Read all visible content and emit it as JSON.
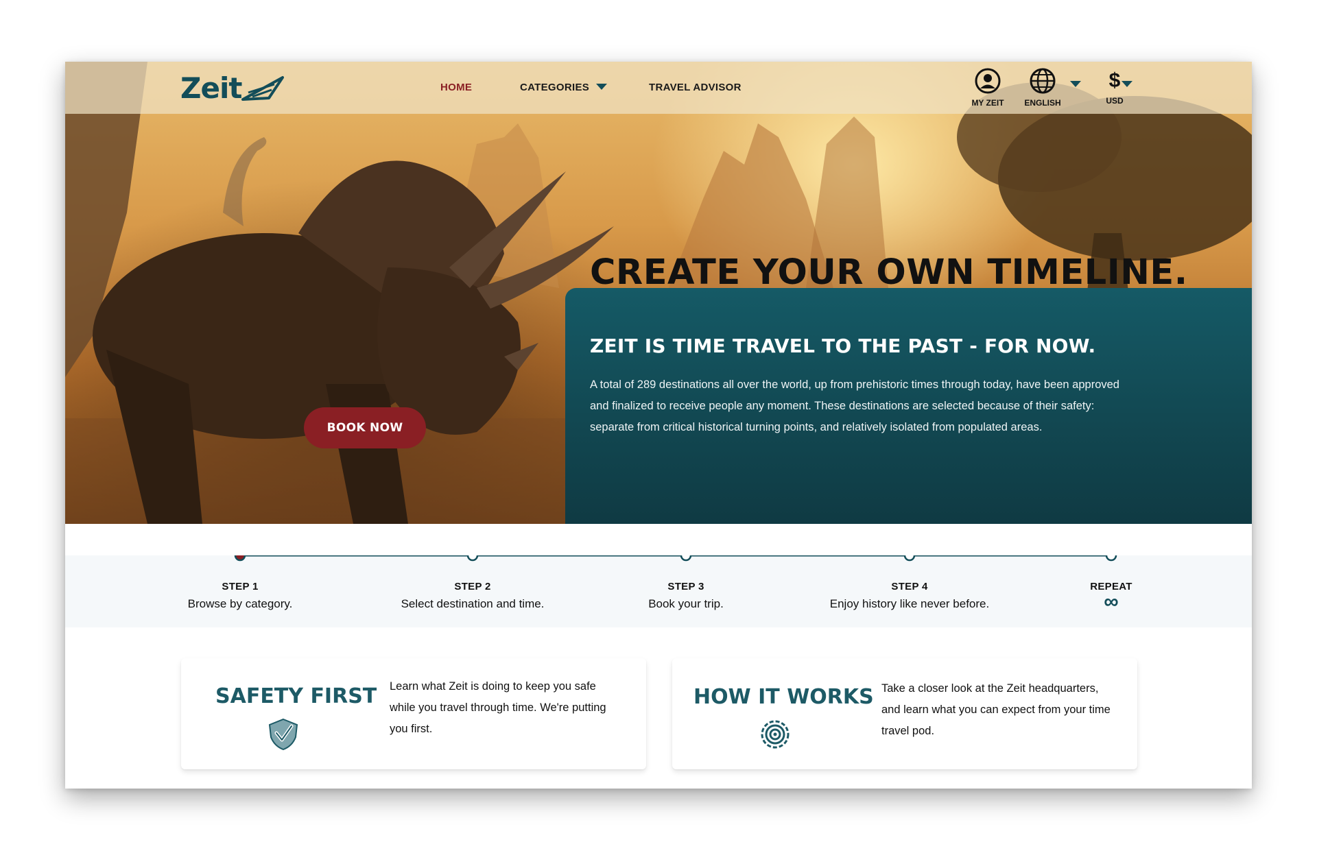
{
  "brand": {
    "logo_text": "Zeit",
    "logo_icon": "time-pod-arrow-icon"
  },
  "nav": {
    "home": "HOME",
    "categories": "CATEGORIES",
    "travel_advisor": "TRAVEL ADVISOR"
  },
  "utilities": {
    "account": {
      "label": "MY ZEIT",
      "icon": "user-circle-icon"
    },
    "language": {
      "label": "ENGLISH",
      "icon": "globe-icon"
    },
    "currency": {
      "label": "USD",
      "symbol": "$"
    }
  },
  "hero": {
    "headline": "CREATE YOUR OWN TIMELINE.",
    "button_label": "BOOK NOW"
  },
  "info": {
    "title": "ZEIT IS TIME TRAVEL TO THE PAST - FOR NOW.",
    "body": "A total of 289 destinations all over the world, up from prehistoric times through today, have been approved and finalized to receive people any moment. These destinations are selected because of their safety: separate from critical historical turning points, and relatively isolated from populated areas."
  },
  "steps": [
    {
      "title": "STEP 1",
      "desc": "Browse by category."
    },
    {
      "title": "STEP 2",
      "desc": "Select destination and time."
    },
    {
      "title": "STEP 3",
      "desc": "Book your trip."
    },
    {
      "title": "STEP 4",
      "desc": "Enjoy history like never before."
    },
    {
      "title": "REPEAT",
      "desc": "∞"
    }
  ],
  "cards": {
    "safety": {
      "title": "SAFETY FIRST",
      "text": "Learn what Zeit is doing to keep you safe while you travel through time. We're putting you first.",
      "icon": "shield-check-icon"
    },
    "how": {
      "title": "HOW IT WORKS",
      "text": "Take a closer look at the Zeit headquarters, and learn what you can expect from your time travel pod.",
      "icon": "target-gear-icon"
    }
  },
  "colors": {
    "brand_teal": "#134d59",
    "accent_red": "#8a1f24",
    "panel_teal": "#155a66"
  }
}
